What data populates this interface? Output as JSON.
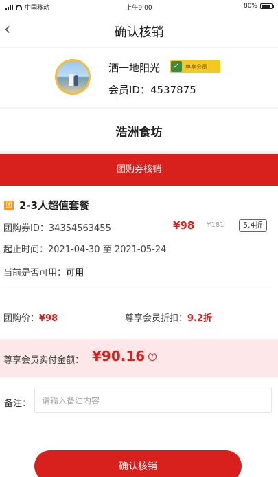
{
  "status_bar": {
    "carrier": "中国移动",
    "time": "上午9:00",
    "battery": "80%"
  },
  "nav": {
    "back_icon": "chevron-left-icon",
    "title": "确认核销"
  },
  "member": {
    "name": "洒一地阳光",
    "badge": "尊享会员",
    "id_label": "会员ID：",
    "id_value": "4537875"
  },
  "shop_name": "浩洲食坊",
  "section_title": "团购券核销",
  "coupon": {
    "icon_text": "团",
    "name": "2-3人超值套餐",
    "id_label": "团购券ID：",
    "id_value": "34354563455",
    "price": "¥98",
    "original_price": "¥181",
    "discount": "5.4折",
    "date_label": "起止时间：",
    "date_range": "2021-04-30 至 2021-05-24",
    "usable_label": "当前是否可用：",
    "usable_value": "可用",
    "group_price_label": "团购价：",
    "group_price_value": "¥98",
    "member_discount_label": "尊享会员折扣：",
    "member_discount_value": "9.2折"
  },
  "payment": {
    "label": "尊享会员实付金额：",
    "amount": "¥90.16"
  },
  "remark": {
    "label": "备注：",
    "placeholder": "请输入备注内容"
  },
  "confirm_button": "确认核销",
  "colors": {
    "accent": "#d8211c",
    "badge": "#f5c820",
    "highlight_bg": "#fde7e8"
  }
}
